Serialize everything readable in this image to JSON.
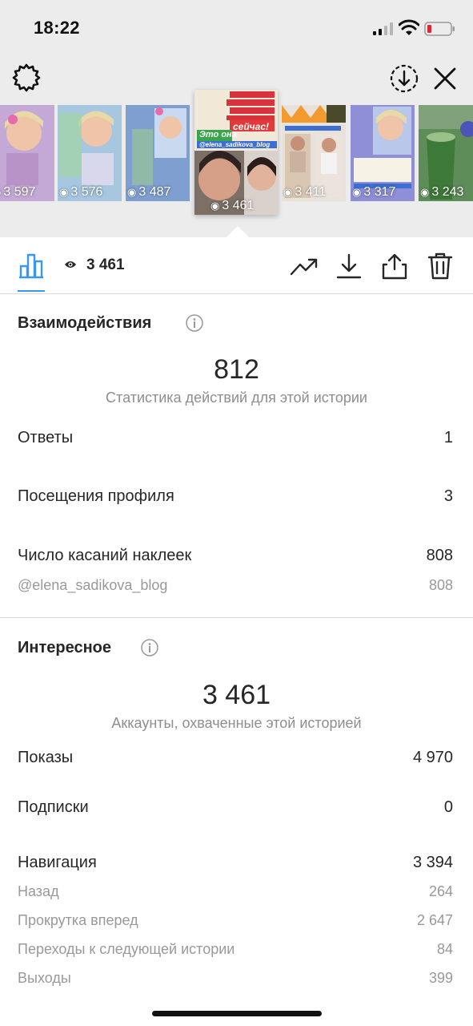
{
  "status_bar": {
    "time": "18:22"
  },
  "stories": [
    {
      "views": "3 597",
      "bg": "#c4a9d6"
    },
    {
      "views": "3 576",
      "bg": "#a7c7e0"
    },
    {
      "views": "3 487",
      "bg": "#7e9fd0"
    },
    {
      "views": "3 461",
      "bg": "#f2e8d8",
      "selected": true
    },
    {
      "views": "3 411",
      "bg": "#d9c7b2"
    },
    {
      "views": "3 317",
      "bg": "#8e8fd6"
    },
    {
      "views": "3 243",
      "bg": "#5e8d5a"
    }
  ],
  "story_texts": {
    "selected_caption_1": "Это она",
    "selected_caption_2": "сейчас!",
    "selected_tag": "@elena_sadikova_blog",
    "tag_small": "@elena_sadikova_blog"
  },
  "toolbar": {
    "views": "3 461"
  },
  "interactions": {
    "title": "Взаимодействия",
    "total": "812",
    "caption": "Статистика действий для этой истории",
    "rows": [
      {
        "label": "Ответы",
        "value": "1"
      },
      {
        "label": "Посещения профиля",
        "value": "3"
      },
      {
        "label": "Число касаний наклеек",
        "value": "808"
      }
    ],
    "sub": {
      "label": "@elena_sadikova_blog",
      "value": "808"
    }
  },
  "discovery": {
    "title": "Интересное",
    "total": "3 461",
    "caption": "Аккаунты, охваченные этой историей",
    "rows": [
      {
        "label": "Показы",
        "value": "4 970"
      },
      {
        "label": "Подписки",
        "value": "0"
      },
      {
        "label": "Навигация",
        "value": "3 394"
      }
    ],
    "navigation": [
      {
        "label": "Назад",
        "value": "264"
      },
      {
        "label": "Прокрутка вперед",
        "value": "2 647"
      },
      {
        "label": "Переходы к следующей истории",
        "value": "84"
      },
      {
        "label": "Выходы",
        "value": "399"
      }
    ]
  },
  "colors": {
    "accent": "#3897f0",
    "muted": "#8e8e8e",
    "divider": "#dbdbdb"
  }
}
